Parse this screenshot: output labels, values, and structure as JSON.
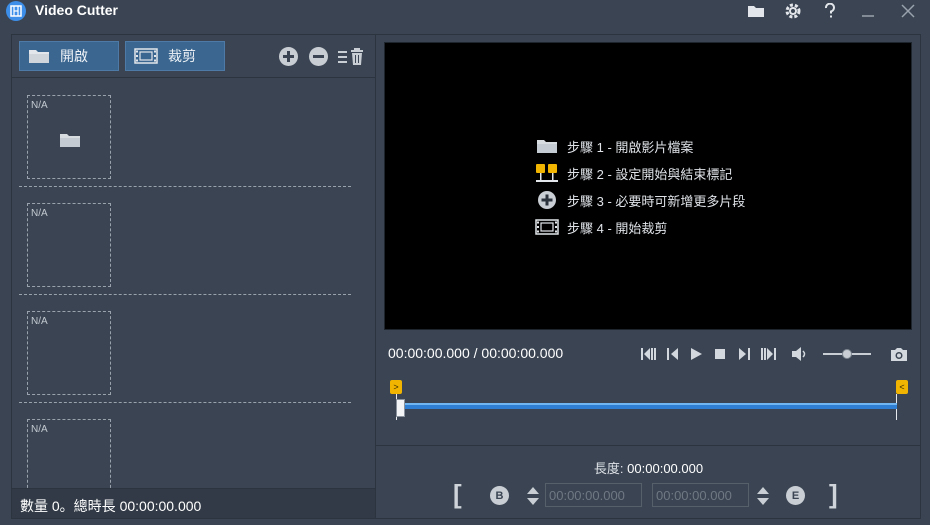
{
  "window": {
    "title": "Video Cutter"
  },
  "toolbar": {
    "open_label": "開啟",
    "cut_label": "裁剪"
  },
  "clips": [
    {
      "label": "N/A"
    },
    {
      "label": "N/A"
    },
    {
      "label": "N/A"
    },
    {
      "label": "N/A"
    }
  ],
  "footer": {
    "summary": "數量 0。總時長 00:00:00.000"
  },
  "player": {
    "steps": [
      {
        "icon": "folder-icon",
        "text": "步驟 1 - 開啟影片檔案"
      },
      {
        "icon": "markers-icon",
        "text": "步驟 2 - 設定開始與結束標記"
      },
      {
        "icon": "add-icon",
        "text": "步驟 3 - 必要時可新增更多片段"
      },
      {
        "icon": "film-icon",
        "text": "步驟 4 - 開始裁剪"
      }
    ],
    "time_readout": "00:00:00.000 / 00:00:00.000",
    "start_marker": ">",
    "end_marker": "<",
    "volume": 0.5
  },
  "trim": {
    "length_label": "長度:",
    "length_value": "00:00:00.000",
    "begin_time": "00:00:00.000",
    "end_time": "00:00:00.000",
    "begin_badge": "B",
    "end_badge": "E",
    "left_bracket": "[",
    "right_bracket": "]"
  },
  "colors": {
    "background": "#3a4452",
    "button": "#3a6690",
    "timeline": "#2f80d4",
    "marker": "#f1b400"
  }
}
